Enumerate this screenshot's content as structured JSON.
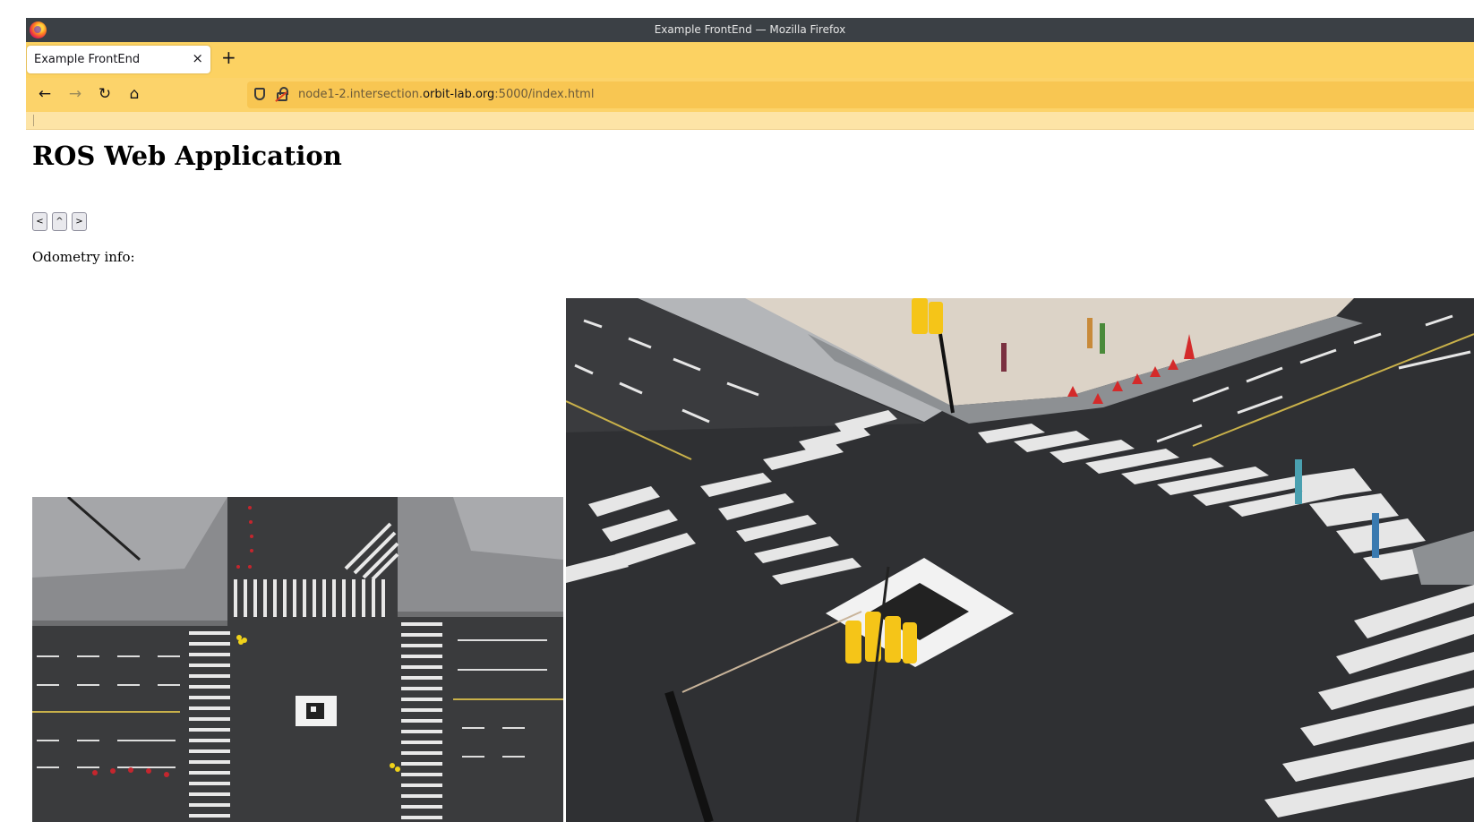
{
  "window": {
    "title": "Example FrontEnd — Mozilla Firefox"
  },
  "tabs": [
    {
      "label": "Example FrontEnd",
      "close": "×"
    }
  ],
  "tabbar": {
    "new_tab": "+"
  },
  "nav": {
    "back": "←",
    "forward": "→",
    "reload": "↻",
    "home": "⌂",
    "url_prefix": "node1-2.intersection.",
    "url_domain": "orbit-lab.org",
    "url_suffix": ":5000/index.html"
  },
  "page": {
    "title": "ROS Web Application",
    "buttons": {
      "left": "<",
      "up": "^",
      "right": ">"
    },
    "odometry_label": "Odometry info:"
  },
  "icons": {
    "app": "firefox-icon",
    "tracking": "shield-icon",
    "security": "insecure-lock-icon"
  },
  "colors": {
    "titlebar": "#3b4045",
    "tabbar": "#fcd262",
    "navbar": "#fcd36a",
    "urlbar": "#f8c652",
    "bookmarks": "#fde4a6"
  }
}
